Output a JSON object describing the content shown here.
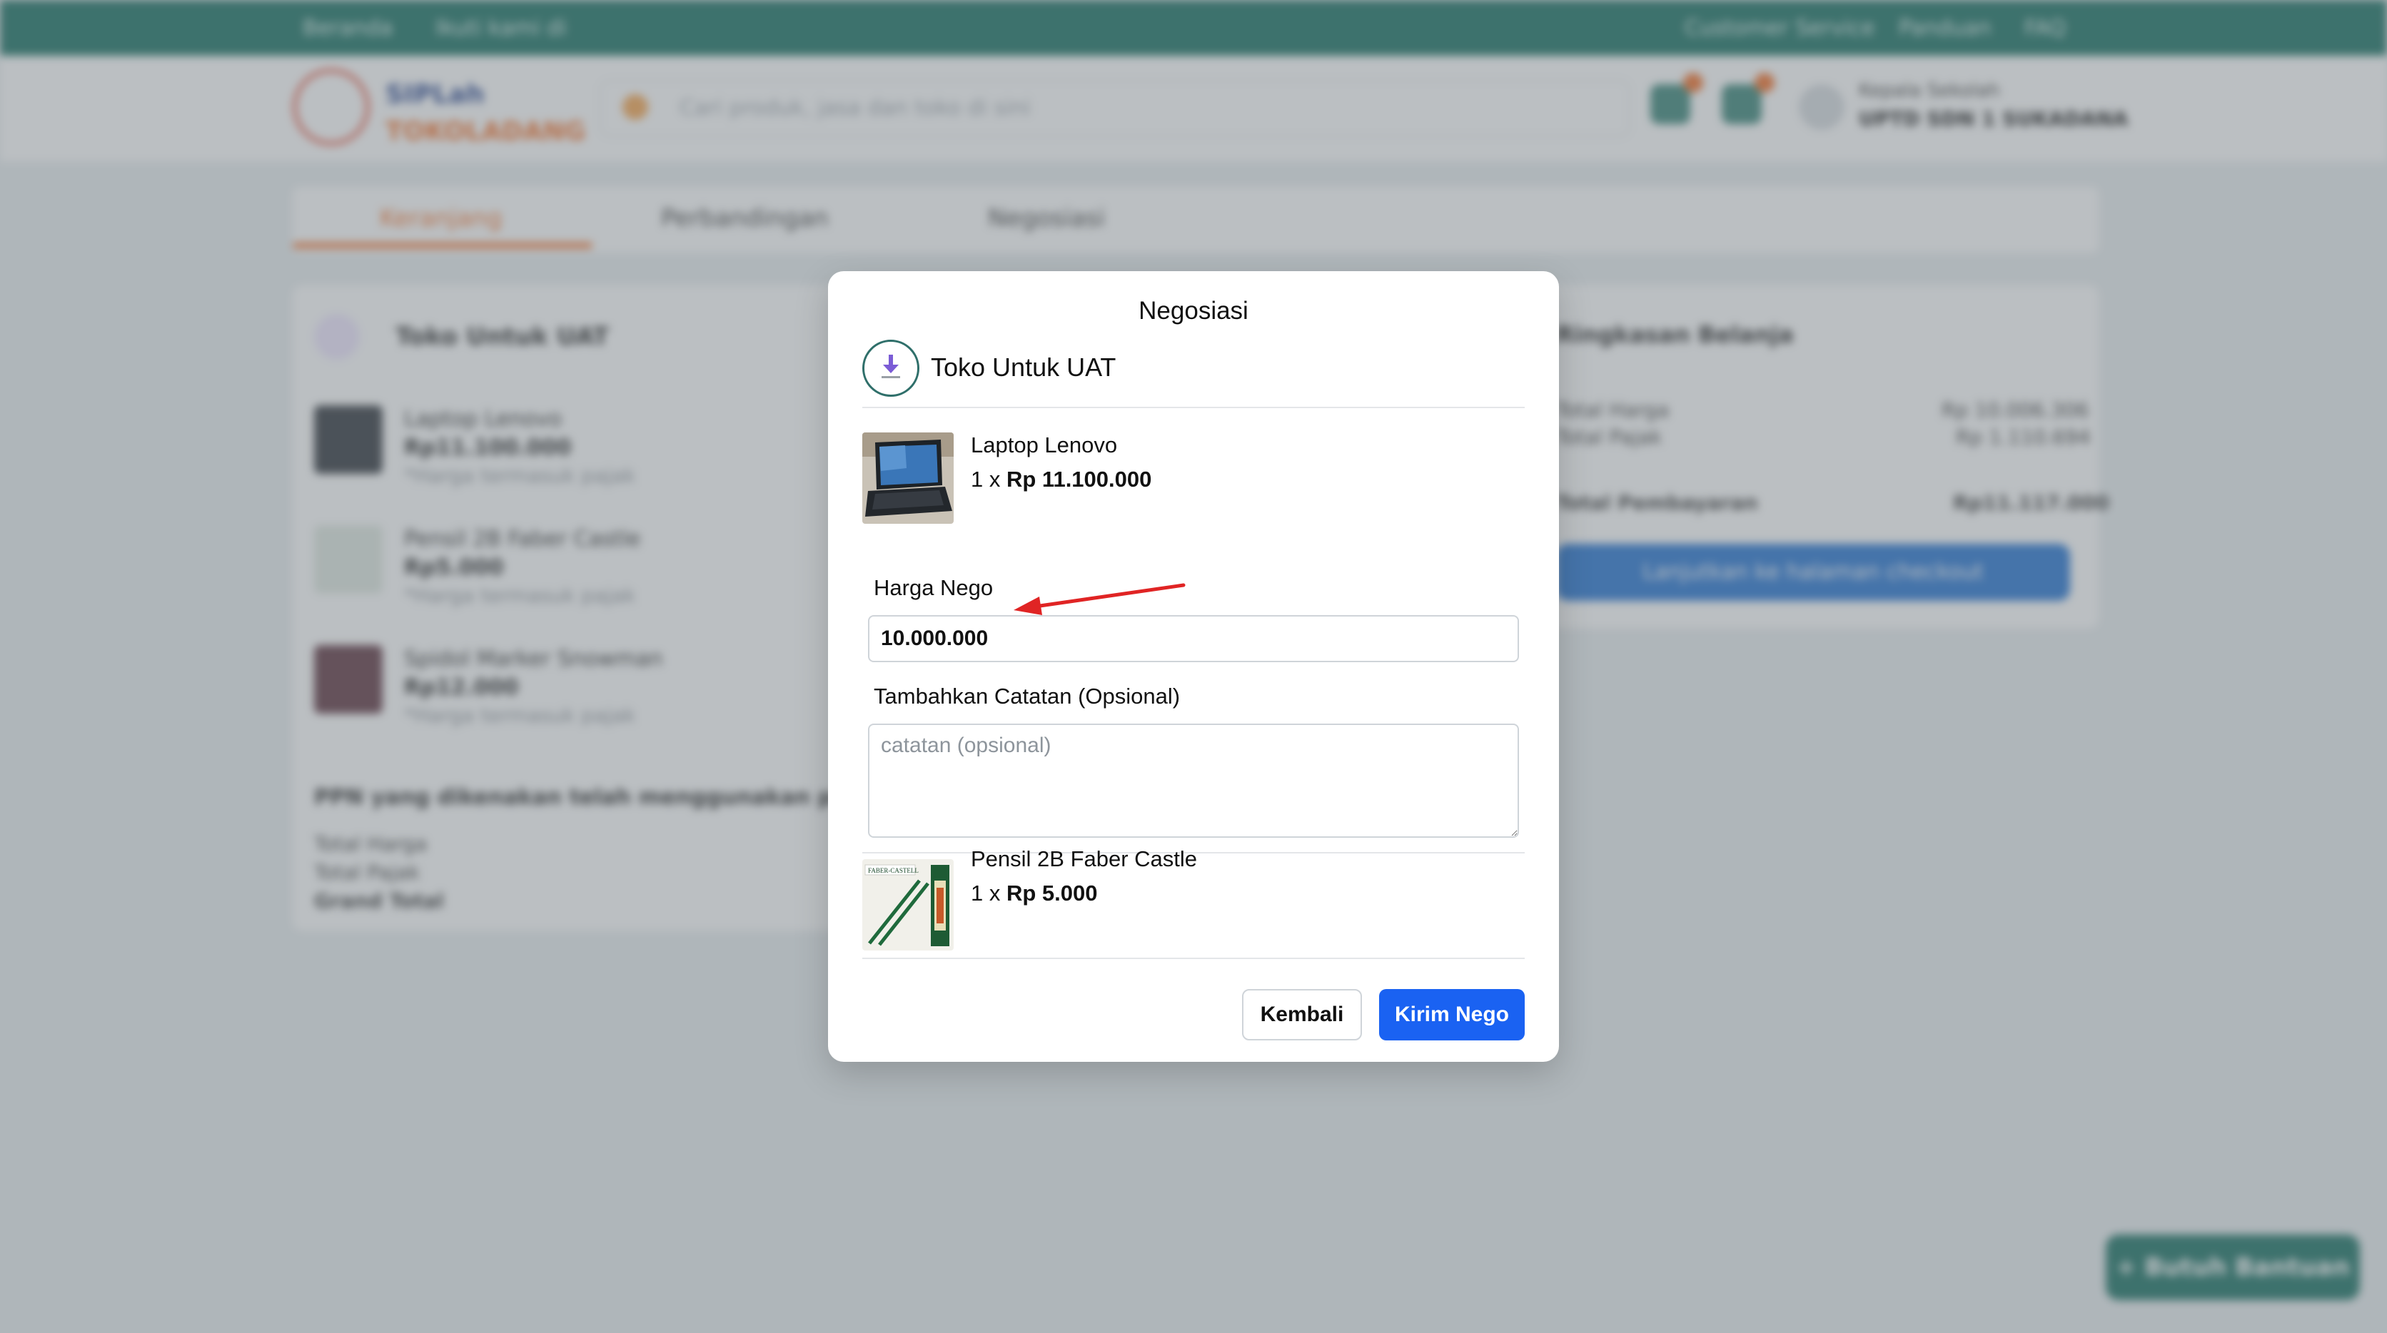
{
  "background": {
    "topbar": {
      "left_items": [
        "Beranda",
        "Ikuti kami di"
      ],
      "right_items": [
        "Customer Service",
        "Panduan",
        "FAQ"
      ]
    },
    "logo": {
      "line1": "SIPLah",
      "line2": "TOKOLADANG"
    },
    "search": {
      "placeholder": "Cari produk, jasa dan toko di sini"
    },
    "user": {
      "role": "Kepala Sekolah",
      "name": "UPTD SDN 1 SUKADANA"
    },
    "tabs": [
      "Keranjang",
      "Perbandingan",
      "Negosiasi"
    ],
    "store_name": "Toko Untuk UAT",
    "products": [
      {
        "name": "Laptop Lenovo",
        "price": "Rp11.100.000",
        "tax": "*Harga termasuk pajak"
      },
      {
        "name": "Pensil 2B Faber Castle",
        "price": "Rp5.000",
        "tax": "*Harga termasuk pajak"
      },
      {
        "name": "Spidol Marker Snowman",
        "price": "Rp12.000",
        "tax": "*Harga termasuk pajak"
      }
    ],
    "ppn_note": "PPN yang dikenakan telah menggunakan perhitungan",
    "summary_labels": [
      "Total Harga",
      "Total Pajak",
      "Grand Total"
    ],
    "right_panel": {
      "title": "Ringkasan Belanja",
      "rows": [
        {
          "label": "Total Harga",
          "value": "Rp 10.006.306"
        },
        {
          "label": "Total Pajak",
          "value": "Rp 1.110.694"
        },
        {
          "label": "Total Pembayaran",
          "value": "Rp11.117.000"
        }
      ],
      "button": "Lanjutkan ke halaman checkout"
    },
    "help_button": "+ Butuh Bantuan"
  },
  "modal": {
    "title": "Negosiasi",
    "store_name": "Toko Untuk UAT",
    "items": [
      {
        "name": "Laptop Lenovo",
        "qty": "1 x",
        "price": "Rp 11.100.000"
      },
      {
        "name": "Pensil 2B Faber Castle",
        "qty": "1 x",
        "price": "Rp 5.000"
      }
    ],
    "harga_nego_label": "Harga Nego",
    "harga_nego_value": "10.000.000",
    "catatan_label": "Tambahkan Catatan (Opsional)",
    "catatan_placeholder": "catatan (opsional)",
    "back_button": "Kembali",
    "send_button": "Kirim Nego",
    "annotation_color": "#e02424"
  }
}
